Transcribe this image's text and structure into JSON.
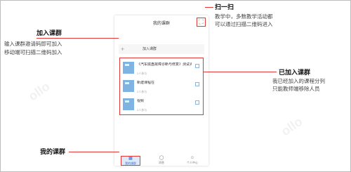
{
  "phone": {
    "title": "我的课群",
    "scan_icon": "scan-icon",
    "join_label": "加入课群",
    "courses": [
      {
        "name": "《汽车底盘故障诊断与修复》测试课群",
        "meta": "2人参与"
      },
      {
        "name": "新建课程在",
        "meta": "2人参与"
      },
      {
        "name": "视频",
        "meta": "2人参与"
      }
    ],
    "tabs": [
      {
        "label": "我的课群",
        "icon": "home-icon",
        "active": true
      },
      {
        "label": "消息",
        "icon": "message-icon",
        "active": false
      },
      {
        "label": "个人中心",
        "icon": "user-icon",
        "active": false
      }
    ]
  },
  "annotations": {
    "scan": {
      "title": "扫一扫",
      "lines": [
        "教学中，多数教学活动都",
        "可以通过扫描二维码进入"
      ]
    },
    "join": {
      "title": "加入课群",
      "lines": [
        "输入课群邀请码即可加入",
        "移动端可扫描二维码加入"
      ]
    },
    "joined": {
      "title": "已加入课群",
      "lines": [
        "我已经加入的课程分列",
        "只能教师端移除人员"
      ]
    },
    "mine": {
      "title": "我的课群"
    }
  },
  "colors": {
    "accent": "#e53935",
    "cover": "#7fb3e2",
    "active_tab": "#2f6fd6"
  }
}
